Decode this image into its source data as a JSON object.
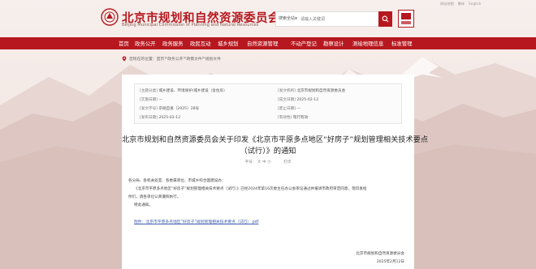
{
  "top_links": [
    "网站地图",
    "繁体",
    "English"
  ],
  "site": {
    "title": "北京市规划和自然资源委员会",
    "subtitle": "Beijing Municipal Commission of Planning and Natural Resources"
  },
  "search": {
    "scope": "搜索全站",
    "placeholder": "请输入关键词"
  },
  "nav": [
    "首页",
    "政务公开",
    "政务服务",
    "政民互动",
    "城乡规划",
    "自然资源管理",
    "不动产登记",
    "勘察设计",
    "测绘地理信息",
    "标准管理"
  ],
  "breadcrumb": {
    "prefix": "您现在的位置：",
    "items": [
      "首页",
      "政务公开",
      "政策文件",
      "规划文件"
    ],
    "separator": " > "
  },
  "meta": {
    "rows": [
      {
        "k": "[主题分类]",
        "v": "城乡建设、环境保护/城乡建设（含住房）"
      },
      {
        "k": "[发文机构]",
        "v": "北京市规划和自然资源委员会"
      },
      {
        "k": "[实施日期]",
        "v": "—"
      },
      {
        "k": "[成文日期]",
        "v": "2025-02-12"
      },
      {
        "k": "[发文字号]",
        "v": "京规自发〔2025〕28号"
      },
      {
        "k": "[废止日期]",
        "v": "—"
      },
      {
        "k": "[发布日期]",
        "v": "2025-02-12"
      },
      {
        "k": "[有效性]",
        "v": "现行有效"
      }
    ]
  },
  "document": {
    "title_line1": "北京市规划和自然资源委员会关于印发《北京市平原多点地区“好房子”规划管理相关技术要点",
    "title_line2": "（试行）》的通知",
    "tools": {
      "font": "字号：",
      "sizes": [
        "大",
        "中",
        "小"
      ],
      "print": "打印"
    },
    "salutation": "各分局、各机关处室、各委属单位、市城乡综合国建设办：",
    "para1": "《北京市平原多点地区“好房子”规划管理相关技术要点（试行）》已经2024年第16次委主任办公会审议通过并报请市政府审定同意，现印发给",
    "para2": "你们，请各单位认真遵照执行。",
    "para3": "特此通知。",
    "attachment": "附件：北京市平原多点地区“好房子”规划管理相关技术要点（试行）.pdf",
    "sign_org": "北京市规划和自然资源委员会",
    "sign_date": "2025年2月12日"
  },
  "colors": {
    "brand_red": "#b7181f",
    "link_blue": "#3b5cad"
  }
}
